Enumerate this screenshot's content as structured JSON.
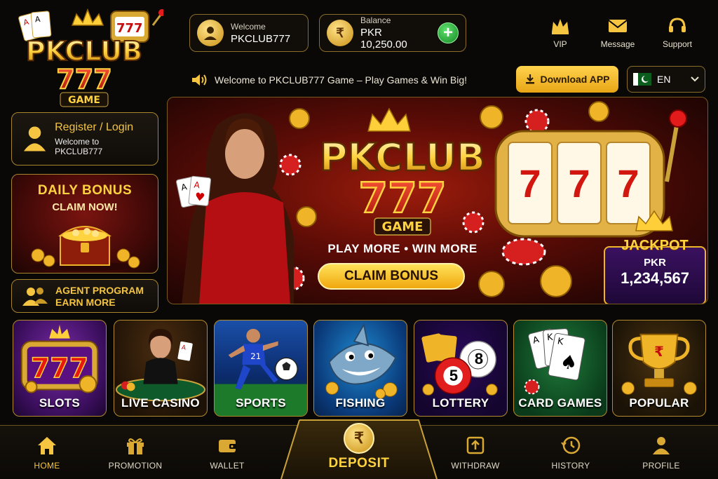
{
  "brand": {
    "logo_main": "PKCLUB",
    "logo_number": "777",
    "logo_sub": "GAME"
  },
  "header": {
    "welcome_label": "Welcome",
    "username": "PKCLUB777",
    "balance_label": "Balance",
    "balance_value": "PKR 10,250.00",
    "add_icon": "+",
    "icons": [
      {
        "name": "crown-icon",
        "label": "VIP"
      },
      {
        "name": "envelope-icon",
        "label": "Message"
      },
      {
        "name": "headset-icon",
        "label": "Support"
      }
    ]
  },
  "ticker": {
    "text": "Welcome to PKCLUB777 Game – Play Games & Win Big!"
  },
  "download_label": "Download APP",
  "language": {
    "selected": "EN",
    "flag": "pakistan-flag-icon"
  },
  "sidebar": {
    "register_title": "Register / Login",
    "register_sub": "Welcome to PKCLUB777",
    "daily_line1": "DAILY BONUS",
    "daily_line2": "CLAIM NOW!",
    "agent_line1": "AGENT PROGRAM",
    "agent_line2": "EARN MORE"
  },
  "banner": {
    "logo_main": "PKCLUB",
    "logo_number": "777",
    "logo_sub": "GAME",
    "tagline": "PLAY MORE • WIN MORE",
    "claim_button": "CLAIM BONUS",
    "slot_reels": [
      "7",
      "7",
      "7"
    ],
    "jackpot_title": "JACKPOT",
    "jackpot_currency": "PKR",
    "jackpot_value": "1,234,567"
  },
  "categories": [
    {
      "label": "SLOTS",
      "icon": "slot-777-icon"
    },
    {
      "label": "LIVE CASINO",
      "icon": "dealer-icon"
    },
    {
      "label": "SPORTS",
      "icon": "football-icon"
    },
    {
      "label": "FISHING",
      "icon": "shark-icon"
    },
    {
      "label": "LOTTERY",
      "icon": "lottery-balls-icon",
      "balls": [
        "5",
        "8"
      ]
    },
    {
      "label": "CARD GAMES",
      "icon": "cards-icon"
    },
    {
      "label": "POPULAR",
      "icon": "trophy-icon"
    }
  ],
  "bottom_nav": {
    "home": "HOME",
    "promotion": "PROMOTION",
    "wallet": "WALLET",
    "deposit": "DEPOSIT",
    "deposit_symbol": "₹",
    "withdraw": "WITHDRAW",
    "history": "HISTORY",
    "profile": "PROFILE"
  },
  "colors": {
    "gold": "#f5c542",
    "dark_bg": "#0a0806",
    "banner_red": "#9c1c0c",
    "jackpot_purple": "#3a1160",
    "add_green": "#2fbf45"
  }
}
